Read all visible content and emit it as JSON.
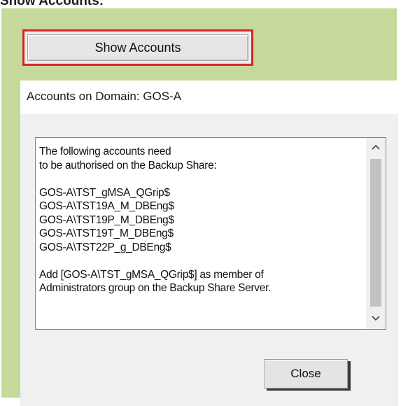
{
  "caption": "Show Accounts:",
  "show_button": {
    "label": "Show Accounts"
  },
  "dialog": {
    "title": "Accounts on Domain: GOS-A",
    "message_lines": [
      "The following accounts need",
      "to be authorised on the Backup Share:",
      "",
      "GOS-A\\TST_gMSA_QGrip$",
      "GOS-A\\TST19A_M_DBEng$",
      "GOS-A\\TST19P_M_DBEng$",
      "GOS-A\\TST19T_M_DBEng$",
      "GOS-A\\TST22P_g_DBEng$",
      "",
      "Add [GOS-A\\TST_gMSA_QGrip$] as member of",
      "Administrators group on the Backup Share Server."
    ],
    "scroll_up_icon": "chevron-up-icon",
    "scroll_down_icon": "chevron-down-icon",
    "close_label": "Close"
  },
  "colors": {
    "panel_background": "#c5d99b",
    "highlight_border": "#d8232a"
  }
}
